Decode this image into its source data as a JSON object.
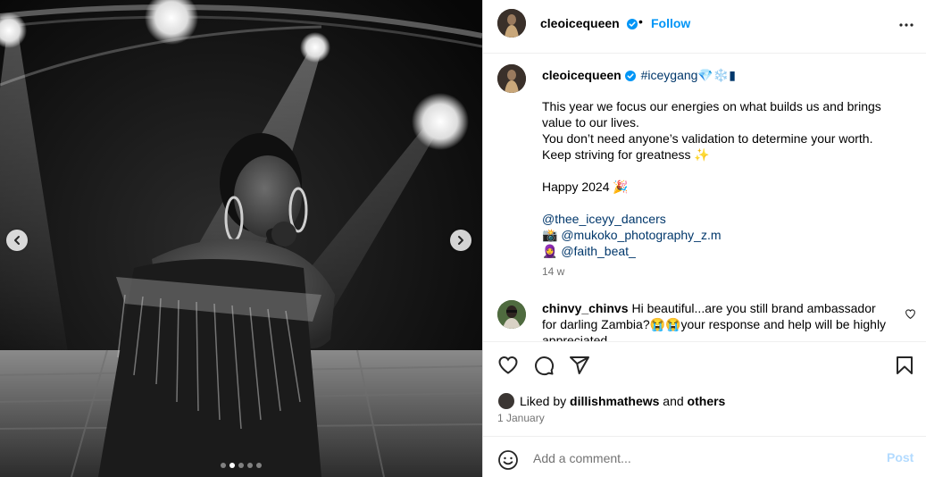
{
  "post": {
    "author": "cleoicequeen",
    "follow_label": "Follow",
    "separator": "•",
    "caption": {
      "tag": "#iceygang💎❄️▮",
      "lines": [
        "This year we focus our energies on what builds us and brings",
        "value to our lives.",
        "You don’t need anyone’s validation to determine your worth.",
        "Keep striving for greatness ✨",
        "",
        "Happy 2024 🎉",
        "",
        "@thee_iceyy_dancers",
        "📸 @mukoko_photography_z.m",
        "🧕 @faith_beat_"
      ],
      "time": "14 w"
    },
    "comments": [
      {
        "user": "chinvy_chinvs",
        "text": "Hi beautiful...are you still brand ambassador for darling Zambia?😭😭your response and help will be highly appreciated"
      }
    ],
    "likes": {
      "prefix": "Liked by",
      "user": "dillishmathews",
      "conj": "and",
      "others": "others"
    },
    "date": "1 January",
    "comment_input": {
      "placeholder": "Add a comment...",
      "value": "",
      "post_label": "Post"
    },
    "carousel": {
      "slide_count": 5,
      "active_index": 1
    }
  },
  "colors": {
    "link_blue": "#0095f6",
    "mention": "#00376b",
    "muted": "#737373",
    "post_disabled": "#b3dbff",
    "verified": "#0095f6"
  },
  "icons": [
    "verified-badge-icon",
    "more-options-icon",
    "chevron-left-icon",
    "chevron-right-icon",
    "heart-icon",
    "comment-icon",
    "share-icon",
    "bookmark-icon",
    "emoji-icon"
  ]
}
